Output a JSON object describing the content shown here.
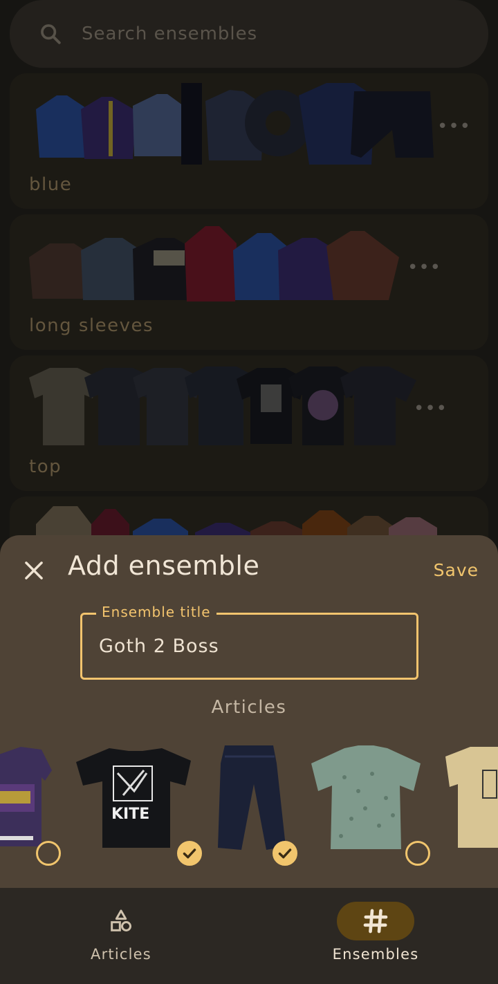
{
  "search": {
    "placeholder": "Search ensembles"
  },
  "ensembles": [
    {
      "label": "blue",
      "more": "•••"
    },
    {
      "label": "long sleeves",
      "more": "•••"
    },
    {
      "label": "top",
      "more": "•••"
    }
  ],
  "sheet": {
    "title": "Add ensemble",
    "save_label": "Save",
    "field_label": "Ensemble title",
    "field_value": "Goth 2 Boss",
    "articles_heading": "Articles",
    "articles": [
      {
        "name": "zelda-tshirt",
        "selected": false
      },
      {
        "name": "kite-tshirt",
        "selected": true
      },
      {
        "name": "dark-jeans",
        "selected": true
      },
      {
        "name": "patterned-shirt",
        "selected": false
      },
      {
        "name": "yellow-tshirt",
        "selected": false
      }
    ]
  },
  "nav": {
    "articles_label": "Articles",
    "ensembles_label": "Ensembles",
    "active": "Ensembles"
  },
  "colors": {
    "accent": "#f1c56d",
    "sheet_bg": "#4f4336",
    "nav_pill": "#5e4513"
  }
}
